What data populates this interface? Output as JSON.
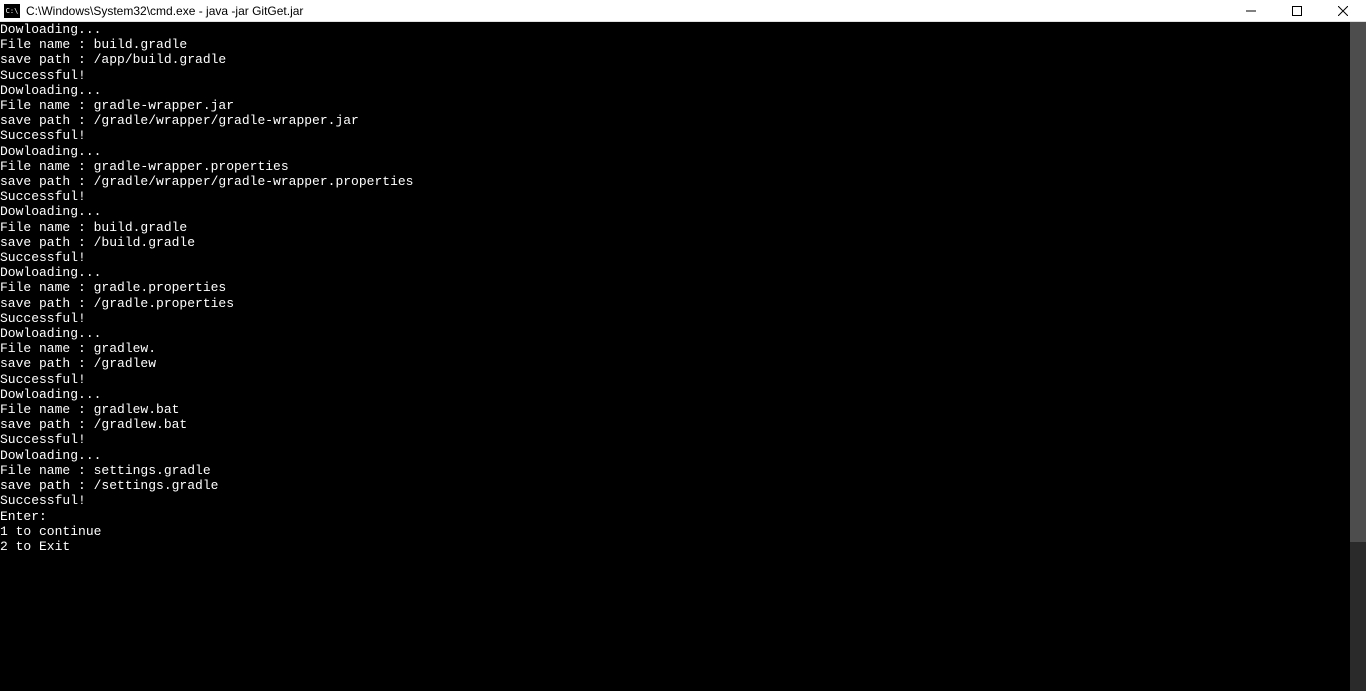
{
  "window": {
    "title": "C:\\Windows\\System32\\cmd.exe - java  -jar GitGet.jar"
  },
  "terminal": {
    "lines": [
      "Dowloading...",
      "File name : build.gradle",
      "save path : /app/build.gradle",
      "Successful!",
      "",
      "Dowloading...",
      "File name : gradle-wrapper.jar",
      "save path : /gradle/wrapper/gradle-wrapper.jar",
      "Successful!",
      "",
      "Dowloading...",
      "File name : gradle-wrapper.properties",
      "save path : /gradle/wrapper/gradle-wrapper.properties",
      "Successful!",
      "",
      "Dowloading...",
      "File name : build.gradle",
      "save path : /build.gradle",
      "Successful!",
      "",
      "Dowloading...",
      "File name : gradle.properties",
      "save path : /gradle.properties",
      "Successful!",
      "",
      "Dowloading...",
      "File name : gradlew.",
      "save path : /gradlew",
      "Successful!",
      "",
      "Dowloading...",
      "File name : gradlew.bat",
      "save path : /gradlew.bat",
      "Successful!",
      "",
      "Dowloading...",
      "File name : settings.gradle",
      "save path : /settings.gradle",
      "Successful!",
      "",
      "Enter:",
      "1 to continue",
      "2 to Exit"
    ]
  }
}
